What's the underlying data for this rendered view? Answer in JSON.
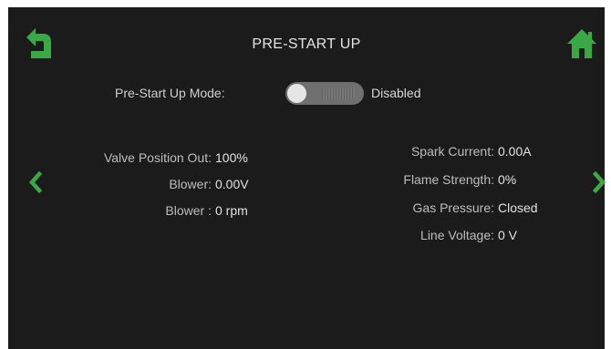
{
  "header": {
    "title": "PRE-START UP"
  },
  "icons": {
    "back": "back-arrow-icon",
    "home": "home-icon",
    "prev": "chevron-left-icon",
    "next": "chevron-right-icon"
  },
  "colors": {
    "accent": "#3aa845",
    "screen_bg": "#1b1b1b",
    "text": "#d8d8d8"
  },
  "mode": {
    "label": "Pre-Start Up Mode:",
    "state": "Disabled",
    "enabled": false
  },
  "readings_left": [
    {
      "label": "Valve Position Out:",
      "value": "100%"
    },
    {
      "label": "Blower:",
      "value": "0.00V"
    },
    {
      "label": "Blower :",
      "value": "0 rpm"
    }
  ],
  "readings_right": [
    {
      "label": "Spark Current:",
      "value": "0.00A"
    },
    {
      "label": "Flame Strength:",
      "value": "0%"
    },
    {
      "label": "Gas Pressure:",
      "value": "Closed"
    },
    {
      "label": "Line Voltage:",
      "value": "0 V"
    }
  ]
}
